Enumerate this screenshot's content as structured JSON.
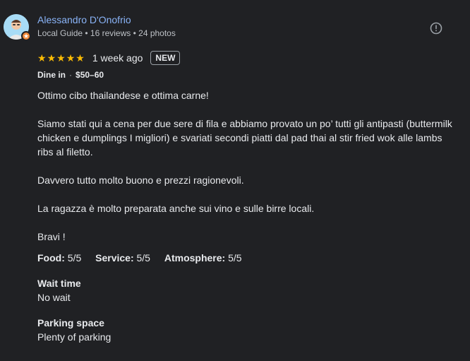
{
  "author": {
    "name": "Alessandro D'Onofrio",
    "meta": "Local Guide • 16 reviews • 24 photos",
    "avatar_icon": "user-avatar",
    "badge_icon": "local-guide-star-icon"
  },
  "report_icon": "report-icon",
  "rating": {
    "stars": 5,
    "max": 5,
    "star_color": "#fbbc04",
    "time_ago": "1 week ago",
    "badge": "NEW"
  },
  "visit": {
    "type": "Dine in",
    "price": "$50–60"
  },
  "review": {
    "paragraphs": [
      "Ottimo cibo thailandese e ottima carne!",
      "Siamo stati qui a cena per due sere di fila e abbiamo provato un po’ tutti gli antipasti (buttermilk chicken e dumplings I migliori) e svariati secondi piatti dal pad thai al stir fried wok alle lambs ribs al filetto.",
      "Davvero tutto molto buono e prezzi ragionevoli.",
      "La ragazza è molto preparata anche sui vino e sulle birre locali.",
      "Bravi !"
    ]
  },
  "sub_ratings": [
    {
      "label": "Food:",
      "value": "5/5"
    },
    {
      "label": "Service:",
      "value": "5/5"
    },
    {
      "label": "Atmosphere:",
      "value": "5/5"
    }
  ],
  "attributes": {
    "wait_time": {
      "label": "Wait time",
      "value": "No wait"
    },
    "parking": {
      "label": "Parking space",
      "value": "Plenty of parking"
    }
  },
  "colors": {
    "background": "#202124",
    "link": "#8ab4f8",
    "text": "#e8eaed",
    "secondary": "#bdc1c6"
  }
}
